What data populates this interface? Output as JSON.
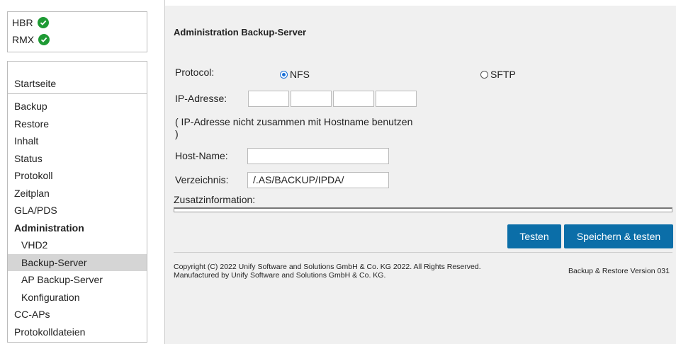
{
  "status": {
    "items": [
      {
        "label": "HBR",
        "icon": "check-circle-icon",
        "color": "#1e9a34"
      },
      {
        "label": "RMX",
        "icon": "check-circle-icon",
        "color": "#1e9a34"
      }
    ]
  },
  "nav": {
    "home": "Startseite",
    "items": [
      {
        "label": "Backup"
      },
      {
        "label": "Restore"
      },
      {
        "label": "Inhalt"
      },
      {
        "label": "Status"
      },
      {
        "label": "Protokoll"
      },
      {
        "label": "Zeitplan"
      },
      {
        "label": "GLA/PDS"
      },
      {
        "label": "Administration"
      },
      {
        "label": "VHD2"
      },
      {
        "label": "Backup-Server"
      },
      {
        "label": "AP Backup-Server"
      },
      {
        "label": "Konfiguration"
      },
      {
        "label": "CC-APs"
      },
      {
        "label": "Protokolldateien"
      }
    ]
  },
  "main": {
    "title": "Administration Backup-Server",
    "protocol_label": "Protocol:",
    "protocol_options": [
      {
        "label": "NFS",
        "selected": true
      },
      {
        "label": "SFTP",
        "selected": false
      }
    ],
    "ip_label": "IP-Adresse:",
    "ip_note": "( IP-Adresse nicht zusammen mit Hostname benutzen )",
    "ip_note_line1": "( IP-Adresse nicht zusammen mit Hostname benutzen",
    "ip_note_line2": ")",
    "host_label": "Host-Name:",
    "host_value": "",
    "dir_label": "Verzeichnis:",
    "dir_value": "/.AS/BACKUP/IPDA/",
    "extra_label": "Zusatzinformation:",
    "buttons": {
      "test": "Testen",
      "save_test": "Speichern & testen"
    },
    "accent_color": "#0b6ea8"
  },
  "footer": {
    "copyright_line1": "Copyright (C) 2022 Unify Software and Solutions GmbH & Co. KG 2022. All Rights Reserved.",
    "copyright_line2": "Manufactured by Unify Software and Solutions GmbH & Co. KG.",
    "version": "Backup & Restore Version 031"
  }
}
